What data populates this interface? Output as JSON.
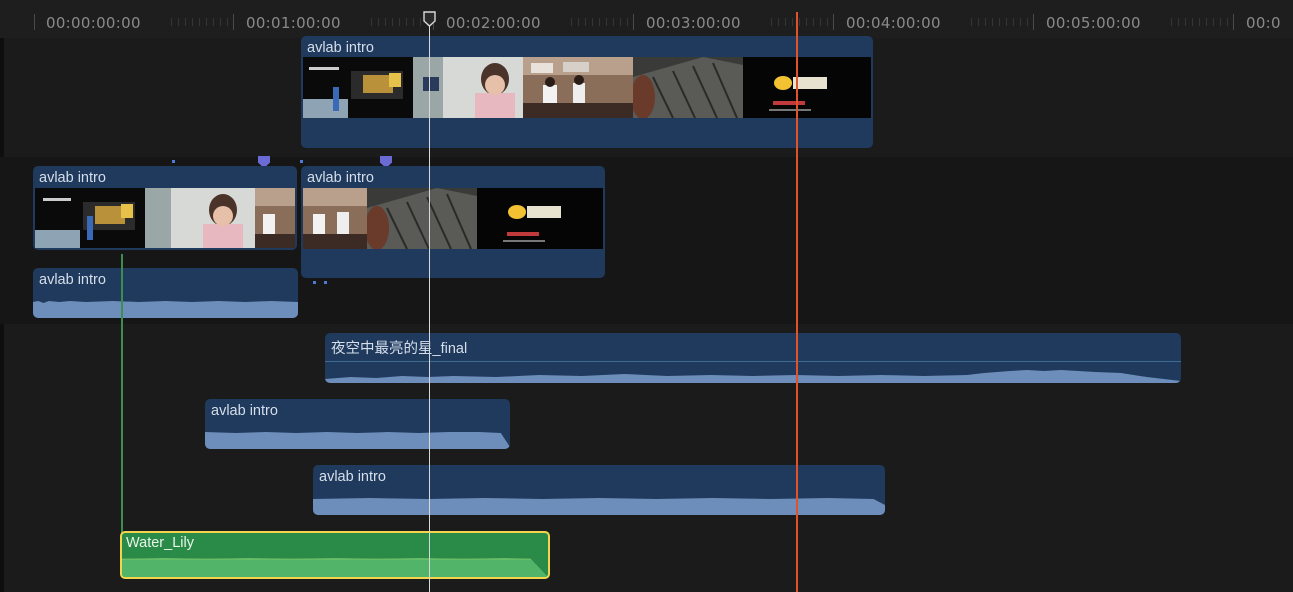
{
  "ruler": {
    "timecodes": [
      "00:00:00:00",
      "00:01:00:00",
      "00:02:00:00",
      "00:03:00:00",
      "00:04:00:00",
      "00:05:00:00",
      "00:0"
    ]
  },
  "clips": {
    "connected_video_top": {
      "label": "avlab intro"
    },
    "primary_clip_1": {
      "label": "avlab intro"
    },
    "primary_clip_2": {
      "label": "avlab intro"
    },
    "audio_clip_1": {
      "label": "avlab intro"
    },
    "music_clip": {
      "label": "夜空中最亮的星_final"
    },
    "audio_clip_2": {
      "label": "avlab intro"
    },
    "audio_clip_3": {
      "label": "avlab intro"
    },
    "selected_clip": {
      "label": "Water_Lily"
    }
  },
  "thumbnail_icons": [
    "title-card-thumbnail",
    "office-people-thumbnail",
    "classroom-thumbnail",
    "mixing-console-thumbnail",
    "logo-thumbnail"
  ],
  "colors": {
    "clip_blue": "#1f3a5c",
    "waveform_blue": "#6d8dbb",
    "selected_border": "#f2d54a",
    "green_clip": "#2a8a48",
    "playhead": "#d8d8d8",
    "skimmer": "#e0522a",
    "marker": "#6b6bd6"
  }
}
